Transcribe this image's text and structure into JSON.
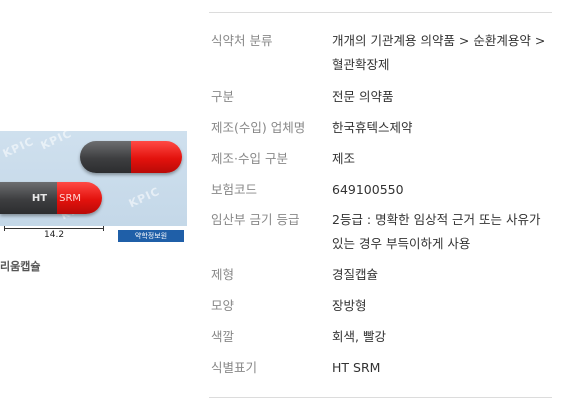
{
  "image": {
    "watermark": "KPIC",
    "capsule_top": {
      "left_color": "#3d3e40",
      "right_color": "#e3120d"
    },
    "capsule_bottom": {
      "left_text": "HT",
      "right_text": "SRM"
    },
    "scale_value": "14.2",
    "badge_text": "약학정보원"
  },
  "drug_name_partial": "리움캡슐",
  "rows": [
    {
      "label": "식약처 분류",
      "value": "개개의 기관계용 의약품 > 순환계용약 > 혈관확장제"
    },
    {
      "label": "구분",
      "value": "전문 의약품"
    },
    {
      "label": "제조(수입) 업체명",
      "value": "한국휴텍스제약"
    },
    {
      "label": "제조·수입 구분",
      "value": "제조"
    },
    {
      "label": "보험코드",
      "value": "649100550"
    },
    {
      "label": "임산부 금기 등급",
      "value": "2등급 : 명확한 임상적 근거 또는 사유가 있는 경우 부득이하게 사용"
    },
    {
      "label": "제형",
      "value": "경질캡슐"
    },
    {
      "label": "모양",
      "value": "장방형"
    },
    {
      "label": "색깔",
      "value": "회색, 빨강"
    },
    {
      "label": "식별표기",
      "value": "HT SRM"
    }
  ],
  "colors": {
    "label": "#888888",
    "value": "#333333",
    "rule": "#dcdcdc",
    "photo_bg": "#c8dbea"
  }
}
